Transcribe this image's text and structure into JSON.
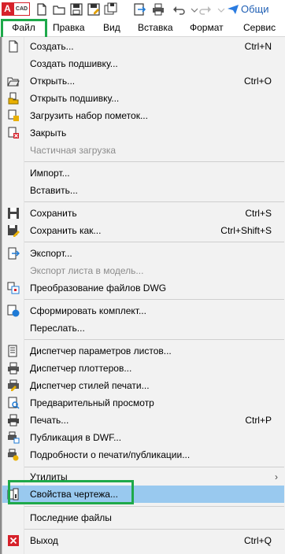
{
  "app": {
    "logo_letter": "A",
    "logo_text": "CAD"
  },
  "qat": {
    "icons": [
      "new-file-icon",
      "open-folder-icon",
      "save-icon",
      "save-as-icon",
      "save-all-icon",
      "export-icon",
      "print-icon",
      "undo-icon",
      "redo-icon"
    ],
    "share_label": "Общи"
  },
  "menubar": {
    "items": [
      "Файл",
      "Правка",
      "Вид",
      "Вставка",
      "Формат",
      "Сервис"
    ]
  },
  "menu": {
    "items": [
      {
        "label": "Создать...",
        "shortcut": "Ctrl+N",
        "icon": "new-file-icon"
      },
      {
        "label": "Создать подшивку...",
        "shortcut": "",
        "icon": ""
      },
      {
        "label": "Открыть...",
        "shortcut": "Ctrl+O",
        "icon": "open-folder-icon"
      },
      {
        "label": "Открыть подшивку...",
        "shortcut": "",
        "icon": "open-sheetset-icon"
      },
      {
        "label": "Загрузить набор пометок...",
        "shortcut": "",
        "icon": "markup-icon"
      },
      {
        "label": "Закрыть",
        "shortcut": "",
        "icon": "close-file-icon"
      },
      {
        "label": "Частичная загрузка",
        "shortcut": "",
        "icon": ""
      },
      {
        "label": "Импорт...",
        "shortcut": "",
        "icon": ""
      },
      {
        "label": "Вставить...",
        "shortcut": "",
        "icon": ""
      },
      {
        "label": "Сохранить",
        "shortcut": "Ctrl+S",
        "icon": "save-icon"
      },
      {
        "label": "Сохранить как...",
        "shortcut": "Ctrl+Shift+S",
        "icon": "save-as-icon"
      },
      {
        "label": "Экспорт...",
        "shortcut": "",
        "icon": "export-icon"
      },
      {
        "label": "Экспорт листа в модель...",
        "shortcut": "",
        "icon": ""
      },
      {
        "label": "Преобразование файлов DWG",
        "shortcut": "",
        "icon": "dwg-convert-icon"
      },
      {
        "label": "Сформировать комплект...",
        "shortcut": "",
        "icon": "etransmit-icon"
      },
      {
        "label": "Переслать...",
        "shortcut": "",
        "icon": ""
      },
      {
        "label": "Диспетчер параметров листов...",
        "shortcut": "",
        "icon": "page-setup-icon"
      },
      {
        "label": "Диспетчер плоттеров...",
        "shortcut": "",
        "icon": "plotter-icon"
      },
      {
        "label": "Диспетчер стилей печати...",
        "shortcut": "",
        "icon": "plot-style-icon"
      },
      {
        "label": "Предварительный просмотр",
        "shortcut": "",
        "icon": "preview-icon"
      },
      {
        "label": "Печать...",
        "shortcut": "Ctrl+P",
        "icon": "print-icon"
      },
      {
        "label": "Публикация в DWF...",
        "shortcut": "",
        "icon": "publish-icon"
      },
      {
        "label": "Подробности о печати/публикации...",
        "shortcut": "",
        "icon": "plot-details-icon"
      },
      {
        "label": "Утилиты",
        "shortcut": "",
        "icon": ""
      },
      {
        "label": "Свойства чертежа...",
        "shortcut": "",
        "icon": "drawing-properties-icon"
      },
      {
        "label": "Последние файлы",
        "shortcut": "",
        "icon": ""
      },
      {
        "label": "Выход",
        "shortcut": "Ctrl+Q",
        "icon": "exit-icon"
      }
    ]
  },
  "colors": {
    "highlight_box": "#1ea94a",
    "active_row": "#99c9ef",
    "menu_bg": "#f2f2f2"
  }
}
